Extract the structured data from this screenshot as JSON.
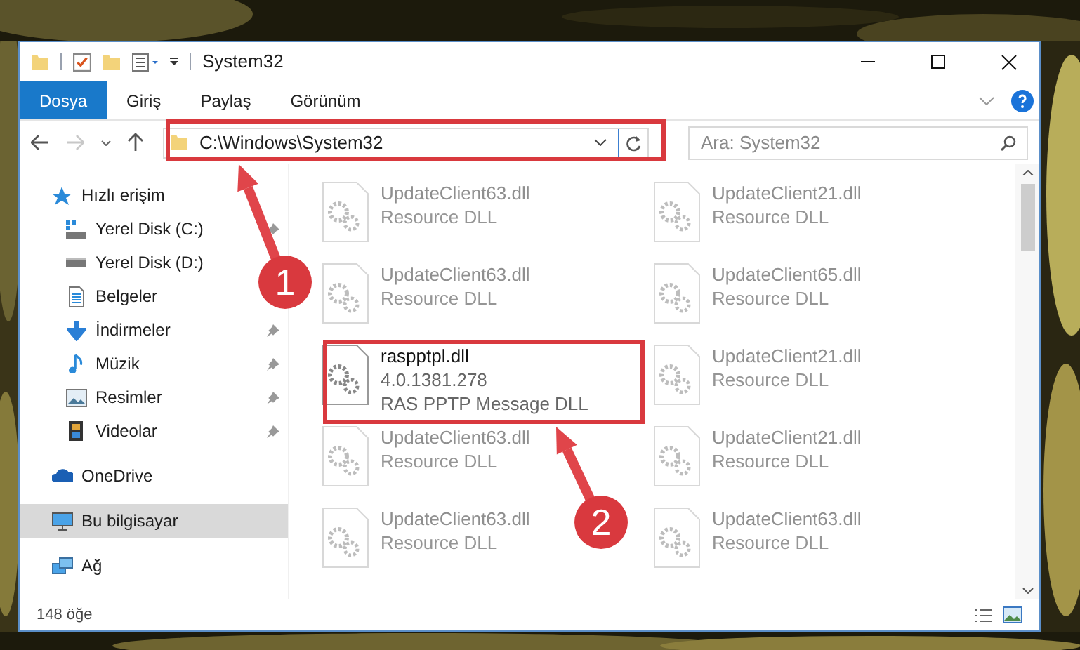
{
  "window": {
    "title": "System32"
  },
  "ribbon": {
    "tabs": [
      {
        "label": "Dosya",
        "selected": true
      },
      {
        "label": "Giriş",
        "selected": false
      },
      {
        "label": "Paylaş",
        "selected": false
      },
      {
        "label": "Görünüm",
        "selected": false
      }
    ]
  },
  "address": {
    "path": "C:\\Windows\\System32"
  },
  "search": {
    "placeholder": "Ara: System32"
  },
  "sidebar": {
    "items": [
      {
        "label": "Hızlı erişim",
        "selected": false,
        "children": [
          {
            "label": "Yerel Disk (C:)",
            "pinned": true
          },
          {
            "label": "Yerel Disk (D:)",
            "pinned": false
          },
          {
            "label": "Belgeler",
            "pinned": false
          },
          {
            "label": "İndirmeler",
            "pinned": true
          },
          {
            "label": "Müzik",
            "pinned": true
          },
          {
            "label": "Resimler",
            "pinned": true
          },
          {
            "label": "Videolar",
            "pinned": true
          }
        ]
      },
      {
        "label": "OneDrive",
        "selected": false
      },
      {
        "label": "Bu bilgisayar",
        "selected": true
      },
      {
        "label": "Ağ",
        "selected": false
      }
    ]
  },
  "files": [
    {
      "name": "UpdateClient63.dll",
      "details": [
        "Resource DLL"
      ],
      "faded": true
    },
    {
      "name": "UpdateClient21.dll",
      "details": [
        "Resource DLL"
      ],
      "faded": true
    },
    {
      "name": "UpdateClient63.dll",
      "details": [
        "Resource DLL"
      ],
      "faded": true
    },
    {
      "name": "UpdateClient65.dll",
      "details": [
        "Resource DLL"
      ],
      "faded": true
    },
    {
      "name": "raspptpl.dll",
      "details": [
        "4.0.1381.278",
        "RAS PPTP Message DLL"
      ],
      "faded": false
    },
    {
      "name": "UpdateClient21.dll",
      "details": [
        "Resource DLL"
      ],
      "faded": true
    },
    {
      "name": "UpdateClient63.dll",
      "details": [
        "Resource DLL"
      ],
      "faded": true
    },
    {
      "name": "UpdateClient21.dll",
      "details": [
        "Resource DLL"
      ],
      "faded": true
    },
    {
      "name": "UpdateClient63.dll",
      "details": [
        "Resource DLL"
      ],
      "faded": true
    },
    {
      "name": "UpdateClient63.dll",
      "details": [
        "Resource DLL"
      ],
      "faded": true
    }
  ],
  "status_bar": {
    "count": "148 öğe"
  },
  "annotations": [
    {
      "number": "1"
    },
    {
      "number": "2"
    }
  ]
}
